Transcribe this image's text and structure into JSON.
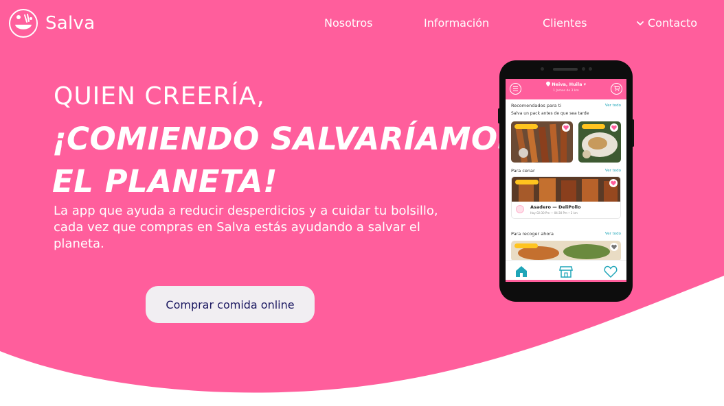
{
  "colors": {
    "brand_pink": "#ff5e9c",
    "white": "#ffffff",
    "button_bg": "#f1eef2",
    "button_text": "#1a1760",
    "teal": "#1fa5b8",
    "badge_yellow": "#ffc41f"
  },
  "navbar": {
    "brand_name": "Salva",
    "links": {
      "nosotros": "Nosotros",
      "informacion": "Información",
      "clientes": "Clientes",
      "contacto": "Contacto"
    }
  },
  "hero": {
    "kicker": "QUIEN CREERÍA,",
    "title_line1": "¡COMIENDO SALVARÍAMOS",
    "title_line2": "EL PLANETA!",
    "description": "La app que ayuda a reducir desperdicios  y a cuidar tu bolsillo, cada vez que compras en Salva estás ayudando a salvar el planeta.",
    "cta_label": "Comprar comida online"
  },
  "phone_app": {
    "location": "Neiva, Huila",
    "location_sub": "1 Jamos de 3 km",
    "sections": [
      {
        "title": "Recomendados para ti",
        "subtitle": "Salva un  pack antes de que sea tarde",
        "link": "Ver todo"
      },
      {
        "title": "Para cenar",
        "link": "Ver todo"
      },
      {
        "title": "Para recoger ahora",
        "link": "Ver todo"
      }
    ],
    "featured_shop": {
      "name": "Asadero — DeliPollo",
      "time": "Hoy 02:30 Pm — 04:30 Pm • 2 km"
    },
    "tabs": [
      "home-icon",
      "store-icon",
      "heart-icon"
    ]
  }
}
